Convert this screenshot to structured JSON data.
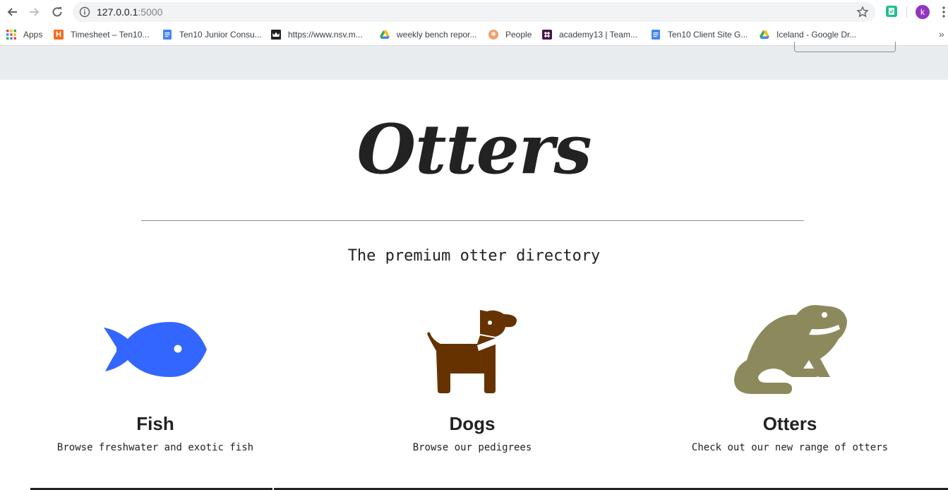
{
  "browser": {
    "url_host": "127.0.0.1",
    "url_port": ":5000",
    "profile_initial": "k"
  },
  "bookmarks": [
    {
      "label": "Apps",
      "icon": "apps-grid-icon"
    },
    {
      "label": "Timesheet – Ten10...",
      "icon": "harvest-h-icon"
    },
    {
      "label": "Ten10 Junior Consu...",
      "icon": "google-docs-icon"
    },
    {
      "label": "https://www.nsv.m...",
      "icon": "crown-icon"
    },
    {
      "label": "weekly bench repor...",
      "icon": "google-drive-icon"
    },
    {
      "label": "People",
      "icon": "people-avatar-icon"
    },
    {
      "label": "academy13 | Team...",
      "icon": "slack-icon"
    },
    {
      "label": "Ten10 Client Site G...",
      "icon": "google-docs-icon"
    },
    {
      "label": "Iceland - Google Dr...",
      "icon": "google-drive-icon"
    }
  ],
  "hero": {
    "title": "Otters",
    "subtitle": "The premium otter directory"
  },
  "cards": [
    {
      "title": "Fish",
      "description": "Browse freshwater and exotic fish",
      "icon": "fish-icon",
      "color": "#3366ff"
    },
    {
      "title": "Dogs",
      "description": "Browse our pedigrees",
      "icon": "dog-icon",
      "color": "#663300"
    },
    {
      "title": "Otters",
      "description": "Check out our new range of otters",
      "icon": "frog-icon",
      "color": "#8c8a5c"
    }
  ]
}
